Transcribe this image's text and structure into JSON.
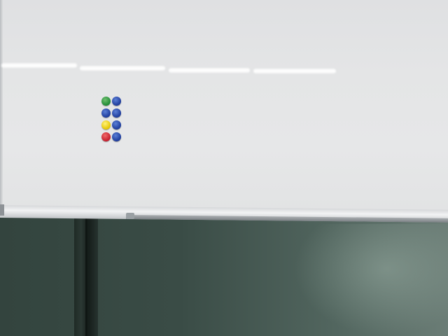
{
  "scene": {
    "description_tag": "whiteboard",
    "colors": {
      "board": "#e4e5e6",
      "wall": "#3a4c46",
      "tray": "#d6d8da"
    }
  },
  "magnets": [
    {
      "color": "green"
    },
    {
      "color": "blue"
    },
    {
      "color": "blue"
    },
    {
      "color": "blue"
    },
    {
      "color": "yellow"
    },
    {
      "color": "blue"
    },
    {
      "color": "red"
    },
    {
      "color": "blue"
    }
  ]
}
